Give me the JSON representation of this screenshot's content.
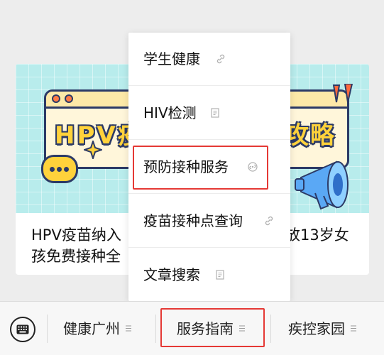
{
  "article": {
    "banner_title_left": "HPV疫",
    "banner_title_right": "攻略",
    "headline_line1": "HPV疫苗纳入",
    "headline_line2": "孩免费接种全",
    "headline_right": "放13岁女"
  },
  "popup_menu": {
    "items": [
      {
        "label": "学生健康",
        "icon": "link-icon"
      },
      {
        "label": "HIV检测",
        "icon": "article-icon"
      },
      {
        "label": "预防接种服务",
        "icon": "miniprogram-icon"
      },
      {
        "label": "疫苗接种点查询",
        "icon": "link-icon"
      },
      {
        "label": "文章搜索",
        "icon": "article-icon"
      }
    ]
  },
  "bottom_menu": {
    "tabs": [
      {
        "label": "健康广州"
      },
      {
        "label": "服务指南"
      },
      {
        "label": "疾控家园"
      }
    ]
  },
  "colors": {
    "highlight": "#e53935",
    "banner_bg": "#b8ecec",
    "title_yellow": "#ffd23b",
    "outline_navy": "#2c3a66"
  }
}
